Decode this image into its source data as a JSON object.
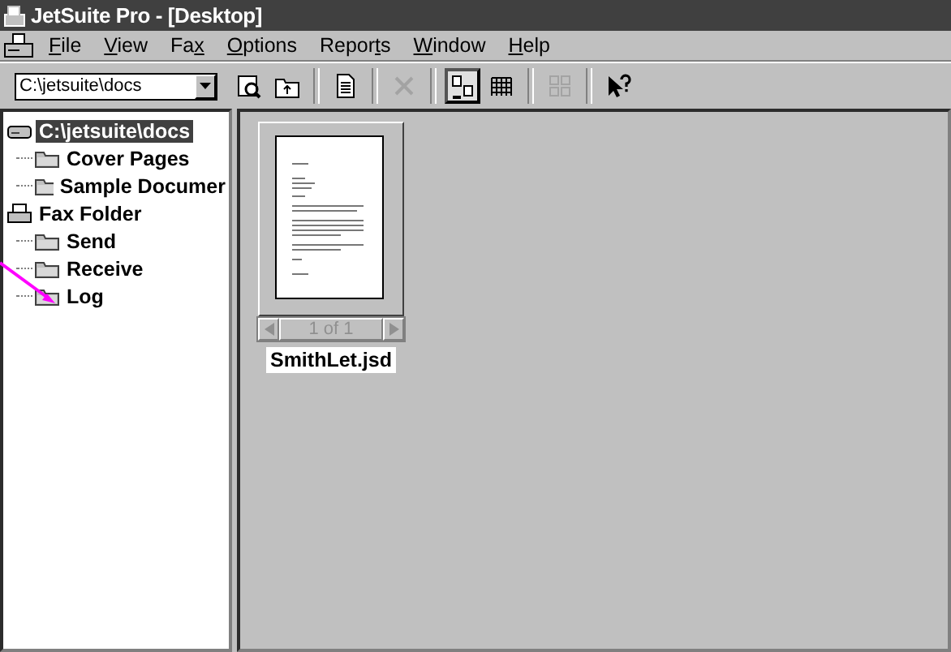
{
  "window": {
    "title": "JetSuite Pro - [Desktop]"
  },
  "menu": [
    {
      "key": "F",
      "after": "ile"
    },
    {
      "key": "V",
      "after": "iew"
    },
    {
      "before": "Fa",
      "key": "x"
    },
    {
      "key": "O",
      "after": "ptions"
    },
    {
      "before": "Repor",
      "key": "t",
      "after": "s"
    },
    {
      "key": "W",
      "after": "indow"
    },
    {
      "key": "H",
      "after": "elp"
    }
  ],
  "toolbar": {
    "path": {
      "value": "C:\\jetsuite\\docs"
    },
    "buttons": [
      {
        "kind": "find",
        "disabled": false,
        "pressed": false
      },
      {
        "kind": "up",
        "disabled": false,
        "pressed": false
      },
      {
        "kind": "document",
        "disabled": false,
        "pressed": false
      },
      {
        "kind": "delete",
        "disabled": true,
        "pressed": false
      },
      {
        "kind": "thumbnails",
        "disabled": false,
        "pressed": true
      },
      {
        "kind": "list",
        "disabled": false,
        "pressed": false
      },
      {
        "kind": "grid",
        "disabled": true,
        "pressed": false
      },
      {
        "kind": "help",
        "disabled": false,
        "pressed": false
      }
    ]
  },
  "tree": [
    {
      "label": "C:\\jetsuite\\docs",
      "kind": "drive",
      "selected": true,
      "children": [
        {
          "label": "Cover Pages",
          "kind": "folder",
          "selected": false
        },
        {
          "label": "Sample Documer",
          "kind": "folder",
          "selected": false
        }
      ]
    },
    {
      "label": "Fax Folder",
      "kind": "fax",
      "selected": false,
      "children": [
        {
          "label": "Send",
          "kind": "folder",
          "selected": false
        },
        {
          "label": "Receive",
          "kind": "folder",
          "selected": false
        },
        {
          "label": "Log",
          "kind": "folder",
          "selected": false
        }
      ]
    }
  ],
  "documents": [
    {
      "name": "SmithLet.jsd",
      "pager": "1 of 1"
    }
  ]
}
